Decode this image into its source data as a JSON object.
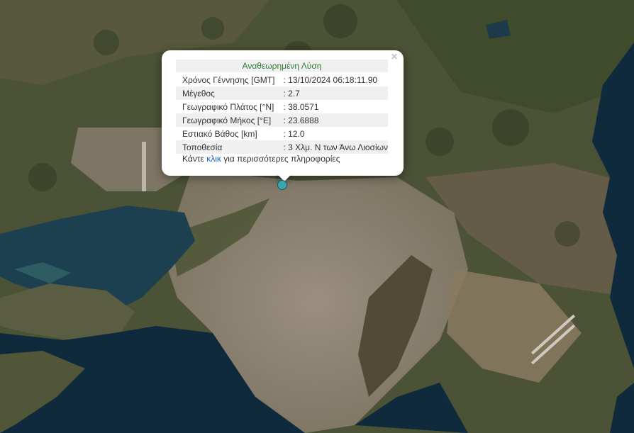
{
  "popup": {
    "title": "Αναθεωρημένη Λύση",
    "close_symbol": "×",
    "rows": [
      {
        "label": "Χρόνος Γέννησης [GMT]",
        "value": ": 13/10/2024 06:18:11.90"
      },
      {
        "label": "Μέγεθος",
        "value": ": 2.7"
      },
      {
        "label": "Γεωγραφικό Πλάτος [°N]",
        "value": ": 38.0571"
      },
      {
        "label": "Γεωγραφικό Μήκος [°E]",
        "value": ": 23.6888"
      },
      {
        "label": "Εστιακό Βάθος [km]",
        "value": ": 12.0"
      },
      {
        "label": "Τοποθεσία",
        "value": ": 3 Χλμ. Ν των Άνω Λιοσίων"
      }
    ],
    "more_prefix": "Κάντε ",
    "more_link": "κλικ",
    "more_suffix": " για περισσότερες πληροφορίες"
  },
  "colors": {
    "title_green": "#2e7d32",
    "link_blue": "#1565c0",
    "marker_fill": "#3aa6b0",
    "sea": "#0f2a3d",
    "urban": "#8f8474",
    "vegetation": "#3d4a2c"
  },
  "icons": {
    "close": "close-icon",
    "marker": "earthquake-marker-icon"
  }
}
